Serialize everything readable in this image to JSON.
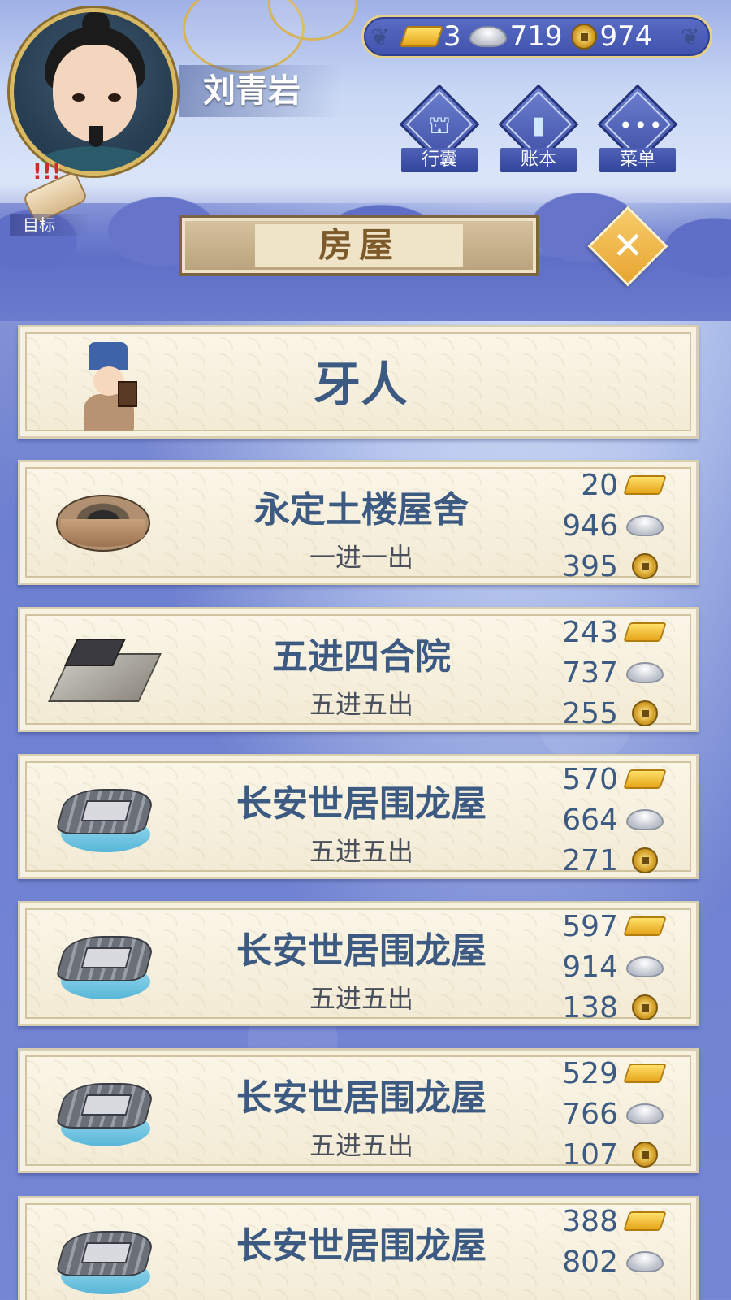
{
  "player": {
    "name": "刘青岩"
  },
  "currency": {
    "gold": "3",
    "silver": "719",
    "copper": "974"
  },
  "target": {
    "label": "目标"
  },
  "menu": [
    {
      "label": "行囊",
      "icon": "bag-icon"
    },
    {
      "label": "账本",
      "icon": "ledger-icon"
    },
    {
      "label": "菜单",
      "icon": "more-icon"
    }
  ],
  "panel": {
    "title": "房屋",
    "close_icon": "close-icon"
  },
  "broker": {
    "label": "牙人"
  },
  "houses": [
    {
      "name": "永定土楼屋舍",
      "layout": "一进一出",
      "gold": "20",
      "silver": "946",
      "copper": "395",
      "type": "tulou"
    },
    {
      "name": "五进四合院",
      "layout": "五进五出",
      "gold": "243",
      "silver": "737",
      "copper": "255",
      "type": "siheyuan"
    },
    {
      "name": "长安世居围龙屋",
      "layout": "五进五出",
      "gold": "570",
      "silver": "664",
      "copper": "271",
      "type": "weilongwu"
    },
    {
      "name": "长安世居围龙屋",
      "layout": "五进五出",
      "gold": "597",
      "silver": "914",
      "copper": "138",
      "type": "weilongwu"
    },
    {
      "name": "长安世居围龙屋",
      "layout": "五进五出",
      "gold": "529",
      "silver": "766",
      "copper": "107",
      "type": "weilongwu"
    },
    {
      "name": "长安世居围龙屋",
      "layout": "",
      "gold": "388",
      "silver": "802",
      "copper": "",
      "type": "weilongwu"
    }
  ],
  "colors": {
    "accent": "#3d5a82",
    "gold": "#e5a51a",
    "frame": "#d9b961"
  }
}
